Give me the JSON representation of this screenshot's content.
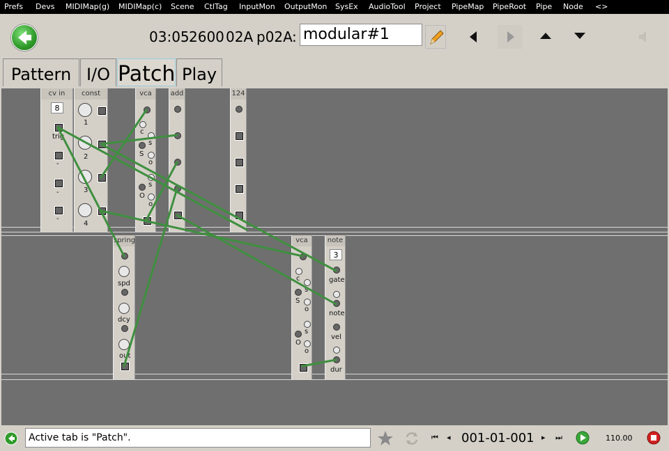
{
  "menu": [
    "Prefs",
    "Devs",
    "MIDIMap(g)",
    "MIDIMap(c)",
    "Scene",
    "CtlTag",
    "InputMon",
    "OutputMon",
    "SysEx",
    "AudioTool",
    "Project",
    "PipeMap",
    "PipeRoot",
    "Pipe",
    "Node",
    "<>"
  ],
  "toolbar": {
    "time": "03:05",
    "tempo_code": "2600",
    "bank": "02A",
    "patch_id": "p02A",
    "separator": ":",
    "patch_name": "modular#1"
  },
  "tabs": [
    "Pattern",
    "I/O",
    "Patch",
    "Play"
  ],
  "active_tab": "Patch",
  "modules": {
    "cv_in": {
      "title": "cv in",
      "value": "8",
      "labels": [
        "trig",
        "-",
        "-",
        "-"
      ]
    },
    "const": {
      "title": "const",
      "labels": [
        "1",
        "2",
        "3",
        "4"
      ]
    },
    "vca_top": {
      "title": "vca",
      "labels": [
        "c",
        "s",
        "S",
        "o",
        "s",
        "O",
        "o"
      ]
    },
    "add": {
      "title": "add"
    },
    "m124": {
      "title": "124"
    },
    "spring": {
      "title": "spring",
      "labels": [
        "spd",
        "dcy",
        "out"
      ]
    },
    "vca_bottom": {
      "title": "vca",
      "labels": [
        "c",
        "s",
        "S",
        "o",
        "s",
        "O",
        "o"
      ]
    },
    "note": {
      "title": "note",
      "value": "3",
      "labels": [
        "gate",
        "note",
        "vel",
        "dur"
      ]
    }
  },
  "status": {
    "message": "Active tab is \"Patch\".",
    "position": "001-01-001",
    "bpm": "110.00"
  },
  "colors": {
    "wire": "#3f8f3f",
    "editor_bg": "#6f6f6f",
    "panel": "#d4d0c8",
    "accent_green": "#2f9a2a",
    "stop_red": "#d12020"
  }
}
